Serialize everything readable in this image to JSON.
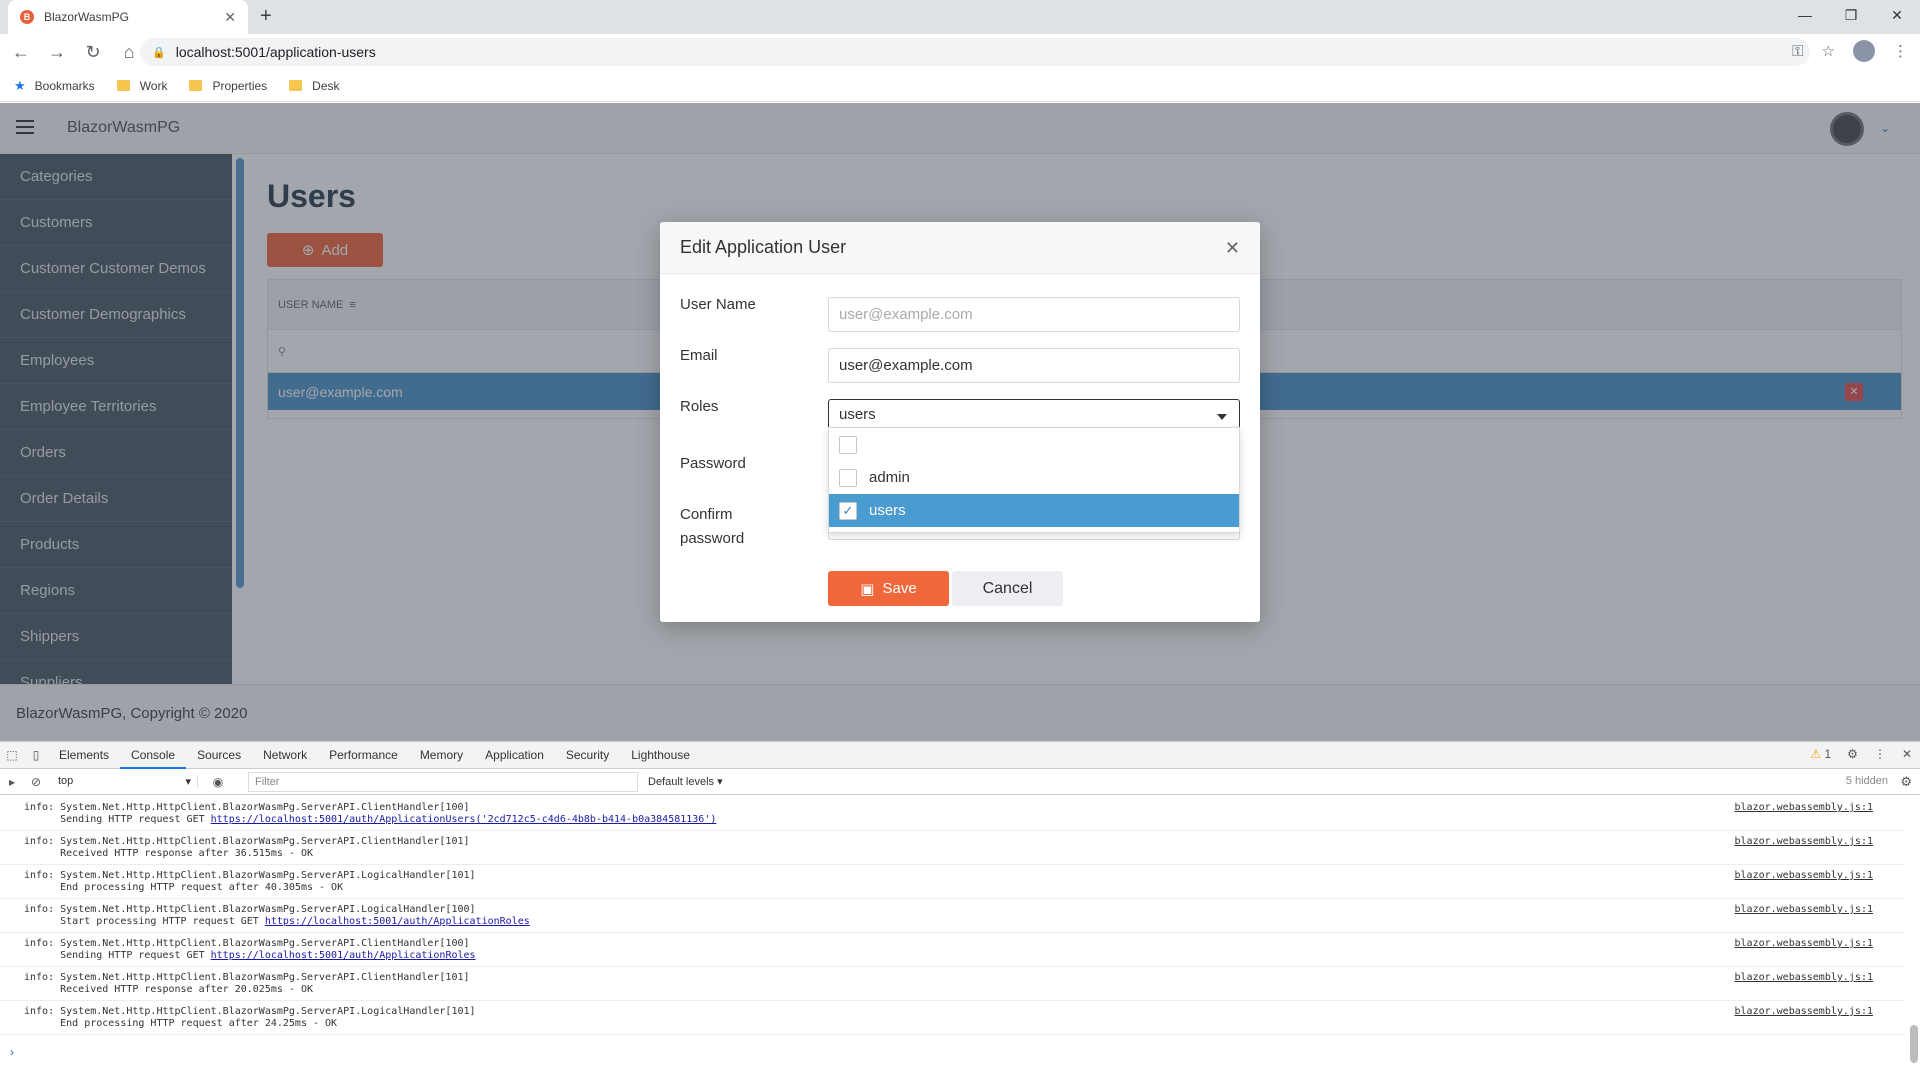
{
  "browser": {
    "tab_title": "BlazorWasmPG",
    "url": "localhost:5001/application-users",
    "bookmarks": [
      "Bookmarks",
      "Work",
      "Properties",
      "Desk"
    ]
  },
  "app": {
    "name": "BlazorWasmPG",
    "footer": "BlazorWasmPG, Copyright © 2020",
    "sidebar": [
      "Categories",
      "Customers",
      "Customer Customer Demos",
      "Customer Demographics",
      "Employees",
      "Employee Territories",
      "Orders",
      "Order Details",
      "Products",
      "Regions",
      "Shippers",
      "Suppliers"
    ]
  },
  "page": {
    "title": "Users",
    "add_label": "Add",
    "grid": {
      "column_header": "USER NAME",
      "rows": [
        "user@example.com"
      ]
    }
  },
  "dialog": {
    "title": "Edit Application User",
    "labels": {
      "username": "User Name",
      "email": "Email",
      "roles": "Roles",
      "password": "Password",
      "confirm_line1": "Confirm",
      "confirm_line2": "password"
    },
    "username_placeholder": "user@example.com",
    "email_value": "user@example.com",
    "roles_value": "users",
    "role_options": [
      {
        "label": "",
        "checked": false
      },
      {
        "label": "admin",
        "checked": false
      },
      {
        "label": "users",
        "checked": true
      }
    ],
    "save_label": "Save",
    "cancel_label": "Cancel"
  },
  "devtools": {
    "tabs": [
      "Elements",
      "Console",
      "Sources",
      "Network",
      "Performance",
      "Memory",
      "Application",
      "Security",
      "Lighthouse"
    ],
    "active_tab": "Console",
    "warnings": "1",
    "context": "top",
    "filter_placeholder": "Filter",
    "levels": "Default levels ▾",
    "hidden": "5 hidden",
    "logs": [
      {
        "l1": "info: System.Net.Http.HttpClient.BlazorWasmPg.ServerAPI.ClientHandler[100]",
        "l2_pre": "      Sending HTTP request GET ",
        "link": "https://localhost:5001/auth/ApplicationUsers('2cd712c5-c4d6-4b8b-b414-b0a384581136')",
        "l2_post": "",
        "src": "blazor.webassembly.js:1"
      },
      {
        "l1": "info: System.Net.Http.HttpClient.BlazorWasmPg.ServerAPI.ClientHandler[101]",
        "l2_pre": "      Received HTTP response after 36.515ms - OK",
        "link": "",
        "l2_post": "",
        "src": "blazor.webassembly.js:1"
      },
      {
        "l1": "info: System.Net.Http.HttpClient.BlazorWasmPg.ServerAPI.LogicalHandler[101]",
        "l2_pre": "      End processing HTTP request after 40.305ms - OK",
        "link": "",
        "l2_post": "",
        "src": "blazor.webassembly.js:1"
      },
      {
        "l1": "info: System.Net.Http.HttpClient.BlazorWasmPg.ServerAPI.LogicalHandler[100]",
        "l2_pre": "      Start processing HTTP request GET ",
        "link": "https://localhost:5001/auth/ApplicationRoles",
        "l2_post": "",
        "src": "blazor.webassembly.js:1"
      },
      {
        "l1": "info: System.Net.Http.HttpClient.BlazorWasmPg.ServerAPI.ClientHandler[100]",
        "l2_pre": "      Sending HTTP request GET ",
        "link": "https://localhost:5001/auth/ApplicationRoles",
        "l2_post": "",
        "src": "blazor.webassembly.js:1"
      },
      {
        "l1": "info: System.Net.Http.HttpClient.BlazorWasmPg.ServerAPI.ClientHandler[101]",
        "l2_pre": "      Received HTTP response after 20.025ms - OK",
        "link": "",
        "l2_post": "",
        "src": "blazor.webassembly.js:1"
      },
      {
        "l1": "info: System.Net.Http.HttpClient.BlazorWasmPg.ServerAPI.LogicalHandler[101]",
        "l2_pre": "      End processing HTTP request after 24.25ms - OK",
        "link": "",
        "l2_post": "",
        "src": "blazor.webassembly.js:1"
      }
    ]
  },
  "colors": {
    "accent": "#f0673c",
    "selected_row": "#4f95c9",
    "sidebar": "#4d5b69"
  }
}
